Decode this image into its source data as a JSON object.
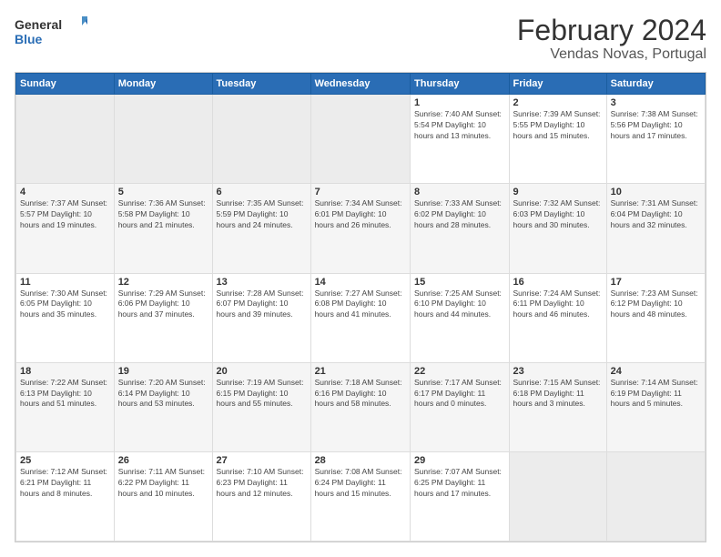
{
  "logo": {
    "line1": "General",
    "line2": "Blue"
  },
  "title": "February 2024",
  "subtitle": "Vendas Novas, Portugal",
  "weekdays": [
    "Sunday",
    "Monday",
    "Tuesday",
    "Wednesday",
    "Thursday",
    "Friday",
    "Saturday"
  ],
  "weeks": [
    [
      {
        "day": "",
        "info": ""
      },
      {
        "day": "",
        "info": ""
      },
      {
        "day": "",
        "info": ""
      },
      {
        "day": "",
        "info": ""
      },
      {
        "day": "1",
        "info": "Sunrise: 7:40 AM\nSunset: 5:54 PM\nDaylight: 10 hours\nand 13 minutes."
      },
      {
        "day": "2",
        "info": "Sunrise: 7:39 AM\nSunset: 5:55 PM\nDaylight: 10 hours\nand 15 minutes."
      },
      {
        "day": "3",
        "info": "Sunrise: 7:38 AM\nSunset: 5:56 PM\nDaylight: 10 hours\nand 17 minutes."
      }
    ],
    [
      {
        "day": "4",
        "info": "Sunrise: 7:37 AM\nSunset: 5:57 PM\nDaylight: 10 hours\nand 19 minutes."
      },
      {
        "day": "5",
        "info": "Sunrise: 7:36 AM\nSunset: 5:58 PM\nDaylight: 10 hours\nand 21 minutes."
      },
      {
        "day": "6",
        "info": "Sunrise: 7:35 AM\nSunset: 5:59 PM\nDaylight: 10 hours\nand 24 minutes."
      },
      {
        "day": "7",
        "info": "Sunrise: 7:34 AM\nSunset: 6:01 PM\nDaylight: 10 hours\nand 26 minutes."
      },
      {
        "day": "8",
        "info": "Sunrise: 7:33 AM\nSunset: 6:02 PM\nDaylight: 10 hours\nand 28 minutes."
      },
      {
        "day": "9",
        "info": "Sunrise: 7:32 AM\nSunset: 6:03 PM\nDaylight: 10 hours\nand 30 minutes."
      },
      {
        "day": "10",
        "info": "Sunrise: 7:31 AM\nSunset: 6:04 PM\nDaylight: 10 hours\nand 32 minutes."
      }
    ],
    [
      {
        "day": "11",
        "info": "Sunrise: 7:30 AM\nSunset: 6:05 PM\nDaylight: 10 hours\nand 35 minutes."
      },
      {
        "day": "12",
        "info": "Sunrise: 7:29 AM\nSunset: 6:06 PM\nDaylight: 10 hours\nand 37 minutes."
      },
      {
        "day": "13",
        "info": "Sunrise: 7:28 AM\nSunset: 6:07 PM\nDaylight: 10 hours\nand 39 minutes."
      },
      {
        "day": "14",
        "info": "Sunrise: 7:27 AM\nSunset: 6:08 PM\nDaylight: 10 hours\nand 41 minutes."
      },
      {
        "day": "15",
        "info": "Sunrise: 7:25 AM\nSunset: 6:10 PM\nDaylight: 10 hours\nand 44 minutes."
      },
      {
        "day": "16",
        "info": "Sunrise: 7:24 AM\nSunset: 6:11 PM\nDaylight: 10 hours\nand 46 minutes."
      },
      {
        "day": "17",
        "info": "Sunrise: 7:23 AM\nSunset: 6:12 PM\nDaylight: 10 hours\nand 48 minutes."
      }
    ],
    [
      {
        "day": "18",
        "info": "Sunrise: 7:22 AM\nSunset: 6:13 PM\nDaylight: 10 hours\nand 51 minutes."
      },
      {
        "day": "19",
        "info": "Sunrise: 7:20 AM\nSunset: 6:14 PM\nDaylight: 10 hours\nand 53 minutes."
      },
      {
        "day": "20",
        "info": "Sunrise: 7:19 AM\nSunset: 6:15 PM\nDaylight: 10 hours\nand 55 minutes."
      },
      {
        "day": "21",
        "info": "Sunrise: 7:18 AM\nSunset: 6:16 PM\nDaylight: 10 hours\nand 58 minutes."
      },
      {
        "day": "22",
        "info": "Sunrise: 7:17 AM\nSunset: 6:17 PM\nDaylight: 11 hours\nand 0 minutes."
      },
      {
        "day": "23",
        "info": "Sunrise: 7:15 AM\nSunset: 6:18 PM\nDaylight: 11 hours\nand 3 minutes."
      },
      {
        "day": "24",
        "info": "Sunrise: 7:14 AM\nSunset: 6:19 PM\nDaylight: 11 hours\nand 5 minutes."
      }
    ],
    [
      {
        "day": "25",
        "info": "Sunrise: 7:12 AM\nSunset: 6:21 PM\nDaylight: 11 hours\nand 8 minutes."
      },
      {
        "day": "26",
        "info": "Sunrise: 7:11 AM\nSunset: 6:22 PM\nDaylight: 11 hours\nand 10 minutes."
      },
      {
        "day": "27",
        "info": "Sunrise: 7:10 AM\nSunset: 6:23 PM\nDaylight: 11 hours\nand 12 minutes."
      },
      {
        "day": "28",
        "info": "Sunrise: 7:08 AM\nSunset: 6:24 PM\nDaylight: 11 hours\nand 15 minutes."
      },
      {
        "day": "29",
        "info": "Sunrise: 7:07 AM\nSunset: 6:25 PM\nDaylight: 11 hours\nand 17 minutes."
      },
      {
        "day": "",
        "info": ""
      },
      {
        "day": "",
        "info": ""
      }
    ]
  ]
}
